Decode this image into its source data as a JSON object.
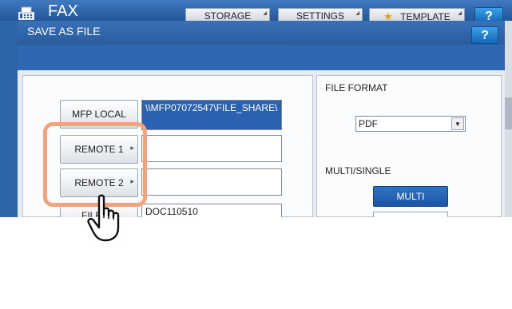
{
  "app": {
    "title": "FAX"
  },
  "toolbar": {
    "storage_label": "STORAGE",
    "settings_label": "SETTINGS",
    "template_label": "TEMPLATE",
    "help_label": "?"
  },
  "dialog": {
    "title": "SAVE AS FILE",
    "help_label": "?",
    "destinations": {
      "mfp_local_label": "MFP LOCAL",
      "mfp_local_path": "\\\\MFP07072547\\FILE_SHARE\\",
      "remote1_label": "REMOTE 1",
      "remote1_path": "",
      "remote2_label": "REMOTE 2",
      "remote2_path": "",
      "file_name_label": "FILE",
      "file_name_value": "DOC110510"
    },
    "file_format": {
      "label": "FILE FORMAT",
      "selected": "PDF"
    },
    "multi_single": {
      "label": "MULTI/SINGLE",
      "selected": "MULTI"
    }
  },
  "colors": {
    "accent_blue": "#2a62b1",
    "highlight": "#f2a27c"
  }
}
